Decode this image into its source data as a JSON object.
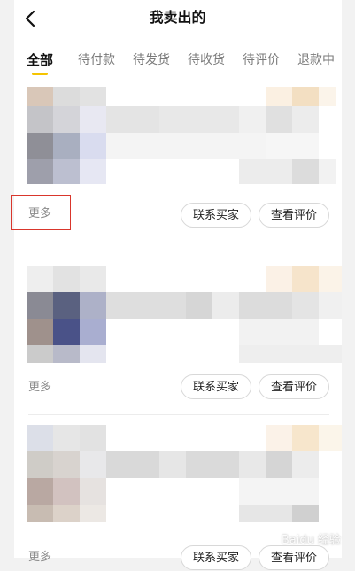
{
  "header": {
    "title": "我卖出的"
  },
  "tabs": [
    {
      "label": "全部",
      "active": true
    },
    {
      "label": "待付款"
    },
    {
      "label": "待发货"
    },
    {
      "label": "待收货"
    },
    {
      "label": "待评价"
    },
    {
      "label": "退款中"
    }
  ],
  "orders": [
    {
      "more_label": "更多",
      "contact_label": "联系买家",
      "review_label": "查看评价"
    },
    {
      "more_label": "更多",
      "contact_label": "联系买家",
      "review_label": "查看评价"
    },
    {
      "more_label": "更多",
      "contact_label": "联系买家",
      "review_label": "查看评价"
    }
  ],
  "annotation": {
    "highlight_target": "更多",
    "color": "#d9362c"
  },
  "watermark": "Baidu 经验",
  "colors": {
    "accent": "#f5c400",
    "background": "#f2f2f2"
  }
}
